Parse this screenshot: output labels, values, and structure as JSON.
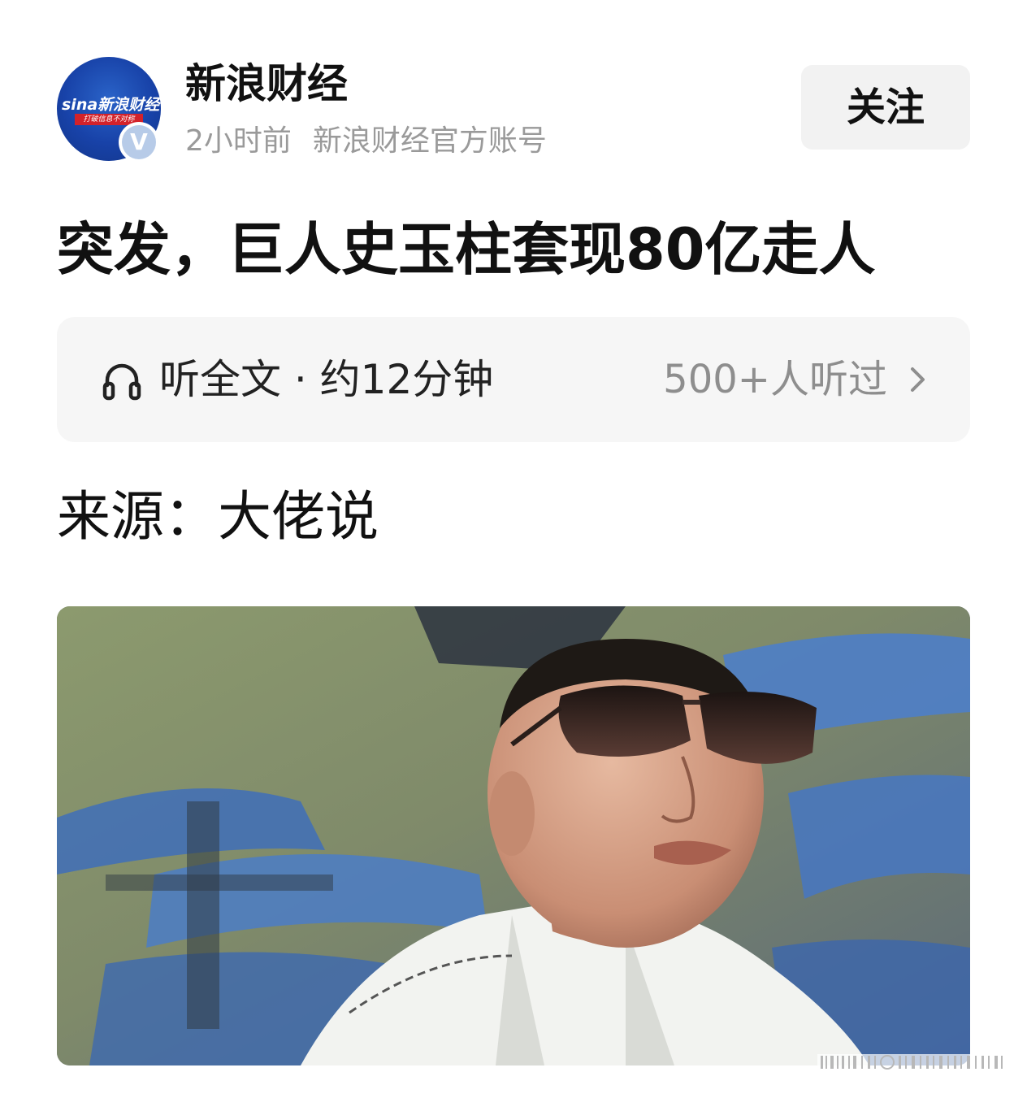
{
  "header": {
    "avatar": {
      "logo_text": "新浪财经",
      "logo_brand": "sina",
      "slogan": "打破信息不对称",
      "verified_mark": "V"
    },
    "author_name": "新浪财经",
    "time_ago": "2小时前",
    "account_type": "新浪财经官方账号",
    "follow_label": "关注"
  },
  "article": {
    "title": "突发，巨人史玉柱套现80亿走人",
    "listen": {
      "icon": "headphone-icon",
      "label": "听全文 · 约12分钟",
      "count": "500+人听过",
      "arrow_icon": "chevron-right-icon"
    },
    "source": "来源：大佬说",
    "photo": {
      "subject": "man in sunglasses and white jacket"
    }
  },
  "colors": {
    "avatar_blue": "#1842a8",
    "follow_bg": "#f2f2f2",
    "listen_bg": "#f6f6f6",
    "meta_gray": "#9a9a9a",
    "count_gray": "#8e8e8e"
  }
}
